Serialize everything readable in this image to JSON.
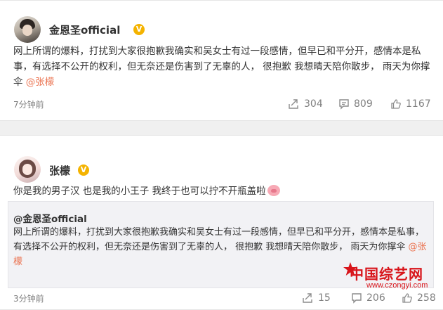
{
  "post": {
    "author": "金恩圣official",
    "verified_badge": "V",
    "text_before_mention": "网上所谓的爆料，打扰到大家很抱歉我确实和吴女士有过一段感情，但早已和平分开，感情本是私事，有选择不公开的权利，但无奈还是伤害到了无辜的人，  很抱歉 我想晴天陪你散步，     雨天为你撑伞 ",
    "mention": "@张檬",
    "time": "7分钟前",
    "reposts": "304",
    "comments": "809",
    "likes": "1167"
  },
  "repost": {
    "author": "张檬",
    "verified_badge": "V",
    "text": "你是我的男子汉  也是我的小王子  我终于也可以拧不开瓶盖啦",
    "emoji_icon": "pig-face-icon",
    "quoted": {
      "author": "@金恩圣official",
      "text_before_mention": "网上所谓的爆料，打扰到大家很抱歉我确实和吴女士有过一段感情，但早已和平分开，感情本是私事，有选择不公开的权利，但无奈还是伤害到了无辜的人，  很抱歉 我想晴天陪你散步，     雨天为你撑伞 ",
      "mention": "@张檬"
    },
    "time": "3分钟前",
    "reposts": "15",
    "comments": "206",
    "likes": "258"
  },
  "watermark": {
    "main": "中国综艺网",
    "sub": "www.czongyi.com"
  },
  "colors": {
    "mention": "#eb7350",
    "badge": "#f4b300",
    "watermark": "#d8151b"
  }
}
